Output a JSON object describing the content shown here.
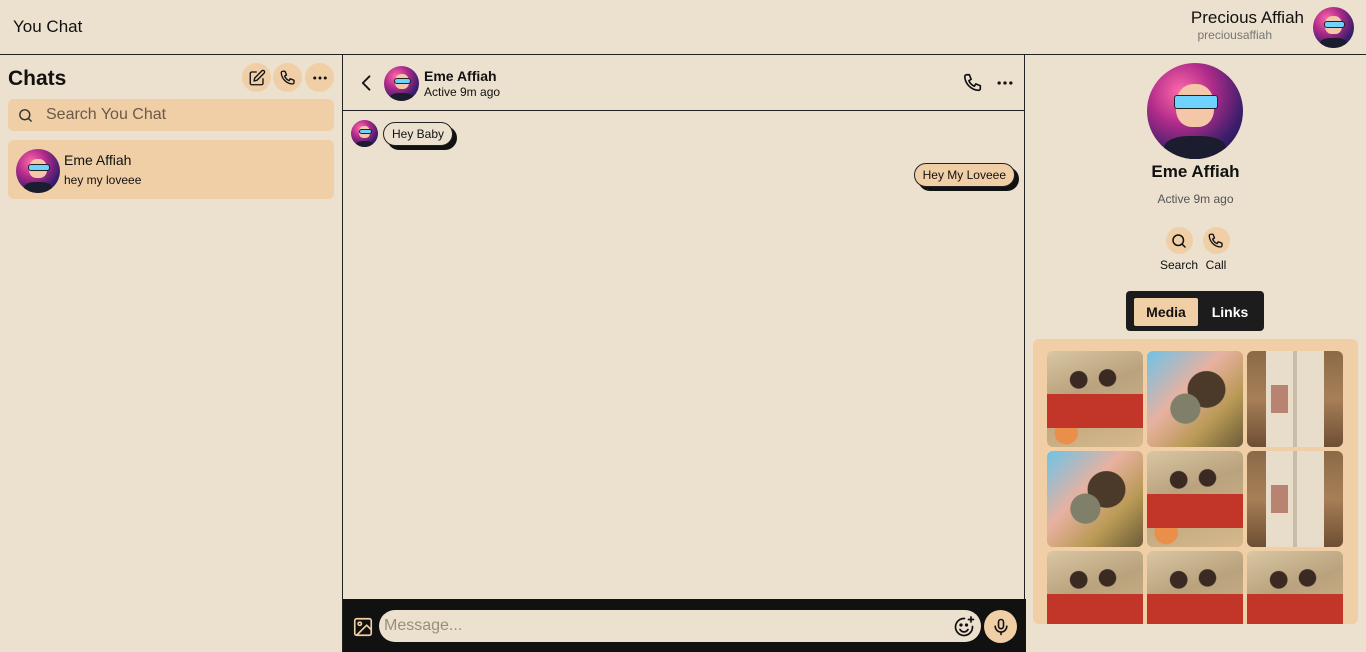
{
  "app": {
    "title": "You Chat"
  },
  "user": {
    "name": "Precious Affiah",
    "handle": "preciousaffiah"
  },
  "sidebar": {
    "title": "Chats",
    "search_placeholder": "Search You Chat",
    "chats": [
      {
        "name": "Eme Affiah",
        "last_message": "hey my loveee"
      }
    ]
  },
  "conversation": {
    "contact_name": "Eme Affiah",
    "status": "Active 9m ago",
    "messages": [
      {
        "direction": "incoming",
        "text": "Hey Baby"
      },
      {
        "direction": "outgoing",
        "text": "Hey My Loveee"
      }
    ],
    "composer_placeholder": "Message..."
  },
  "profile": {
    "name": "Eme Affiah",
    "status": "Active 9m ago",
    "actions": [
      {
        "label": "Search",
        "icon": "search-icon"
      },
      {
        "label": "Call",
        "icon": "phone-icon"
      }
    ],
    "tabs": [
      {
        "label": "Media",
        "active": true
      },
      {
        "label": "Links",
        "active": false
      }
    ],
    "media": [
      {
        "image": "vintage-women-photo"
      },
      {
        "image": "sunglasses-photo"
      },
      {
        "image": "open-book-photo"
      },
      {
        "image": "sunglasses-photo"
      },
      {
        "image": "vintage-women-photo"
      },
      {
        "image": "open-book-photo"
      },
      {
        "image": "vintage-women-photo"
      },
      {
        "image": "vintage-women-photo"
      },
      {
        "image": "vintage-women-photo"
      }
    ]
  },
  "colors": {
    "background": "#ece0ce",
    "accent": "#f0cfa6",
    "dark": "#111111"
  }
}
